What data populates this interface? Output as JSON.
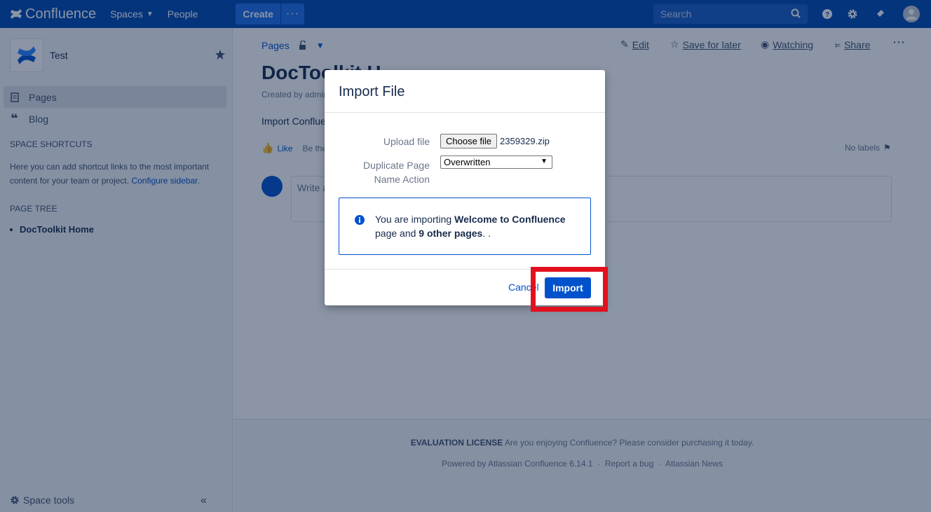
{
  "topnav": {
    "brand": "Confluence",
    "spaces": "Spaces",
    "people": "People",
    "create": "Create",
    "more": "···",
    "search_placeholder": "Search"
  },
  "sidebar": {
    "space_name": "Test",
    "items": [
      {
        "label": "Pages"
      },
      {
        "label": "Blog"
      }
    ],
    "shortcuts_heading": "SPACE SHORTCUTS",
    "shortcuts_text": "Here you can add shortcut links to the most important content for your team or project.",
    "configure_link": "Configure sidebar",
    "page_tree_heading": "PAGE TREE",
    "tree_items": [
      "DocToolkit Home"
    ],
    "space_tools": "Space tools"
  },
  "page": {
    "breadcrumb": "Pages",
    "actions": {
      "edit": "Edit",
      "save_for_later": "Save for later",
      "watching": "Watching",
      "share": "Share"
    },
    "title": "DocToolkit H",
    "byline": "Created by admin",
    "body": "Import Confluence",
    "like": "Like",
    "be_first": "Be the",
    "no_labels": "No labels",
    "comment_placeholder": "Write a"
  },
  "footer": {
    "license_bold": "EVALUATION LICENSE",
    "license_text": " Are you enjoying Confluence? Please consider purchasing it today.",
    "powered": "Powered by Atlassian Confluence 6.14.1",
    "report": "Report a bug",
    "news": "Atlassian News"
  },
  "dialog": {
    "title": "Import File",
    "upload_label": "Upload file",
    "choose_file": "Choose file",
    "file_name": "2359329.zip",
    "duplicate_label_1": "Duplicate Page",
    "duplicate_label_2": "Name Action",
    "duplicate_value": "Overwritten",
    "info_pre": "You are importing ",
    "info_page": "Welcome to Confluence",
    "info_mid": " page and ",
    "info_count": "9 other pages",
    "info_post": ". .",
    "cancel": "Cancel",
    "import": "Import"
  },
  "colors": {
    "nav": "#0049b0",
    "primary": "#0052cc",
    "highlight": "#e3101e"
  }
}
